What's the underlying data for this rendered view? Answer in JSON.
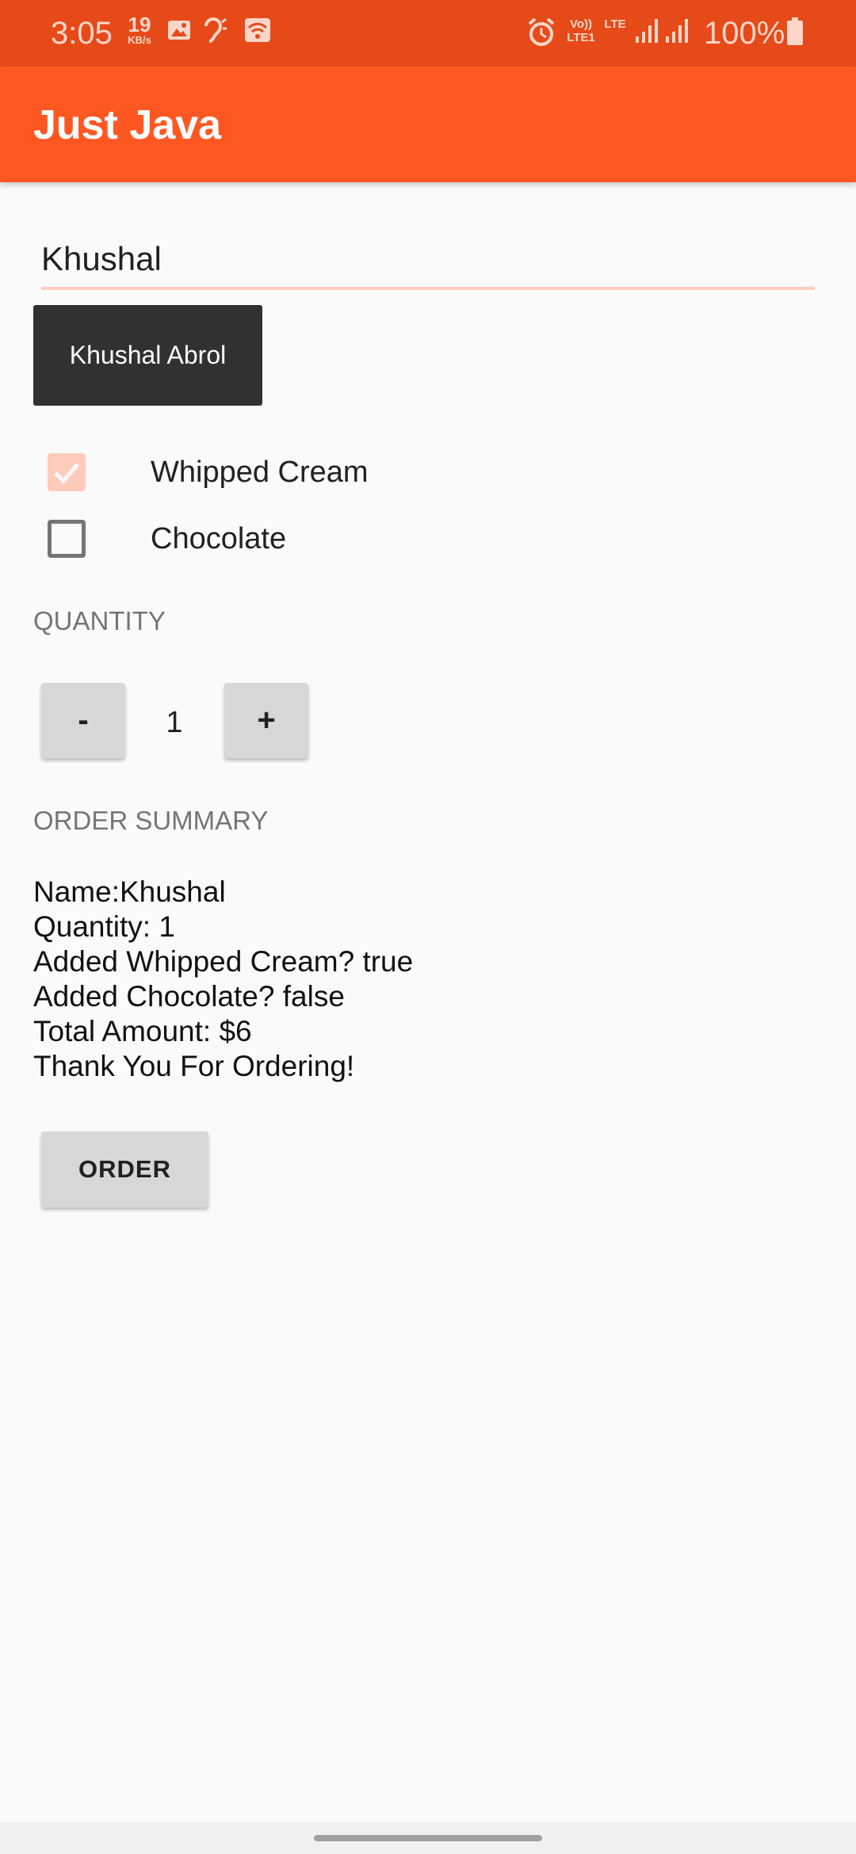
{
  "status_bar": {
    "time": "3:05",
    "net_speed_value": "19",
    "net_speed_unit": "KB/s",
    "volte_label": "Vo)) LTE1",
    "lte_label": "LTE",
    "battery_percent": "100%",
    "icons": [
      "image-icon",
      "hearing-icon",
      "wifi-icon",
      "alarm-icon",
      "signal-icon",
      "signal-icon",
      "battery-icon"
    ],
    "color": "#e64a19"
  },
  "app_bar": {
    "title": "Just Java",
    "color": "#ff5722"
  },
  "name_input": {
    "value": "Khushal"
  },
  "tooltip": {
    "text": "Khushal Abrol"
  },
  "toppings": [
    {
      "label": "Whipped Cream",
      "checked": true
    },
    {
      "label": "Chocolate",
      "checked": false
    }
  ],
  "quantity": {
    "header": "QUANTITY",
    "decrement_label": "-",
    "increment_label": "+",
    "value": "1"
  },
  "order_summary": {
    "header": "ORDER SUMMARY",
    "lines": [
      "Name:Khushal",
      "Quantity: 1",
      "Added Whipped Cream? true",
      "Added Chocolate? false",
      "Total Amount: $6",
      "Thank You For Ordering!"
    ]
  },
  "order_button": {
    "label": "ORDER"
  }
}
